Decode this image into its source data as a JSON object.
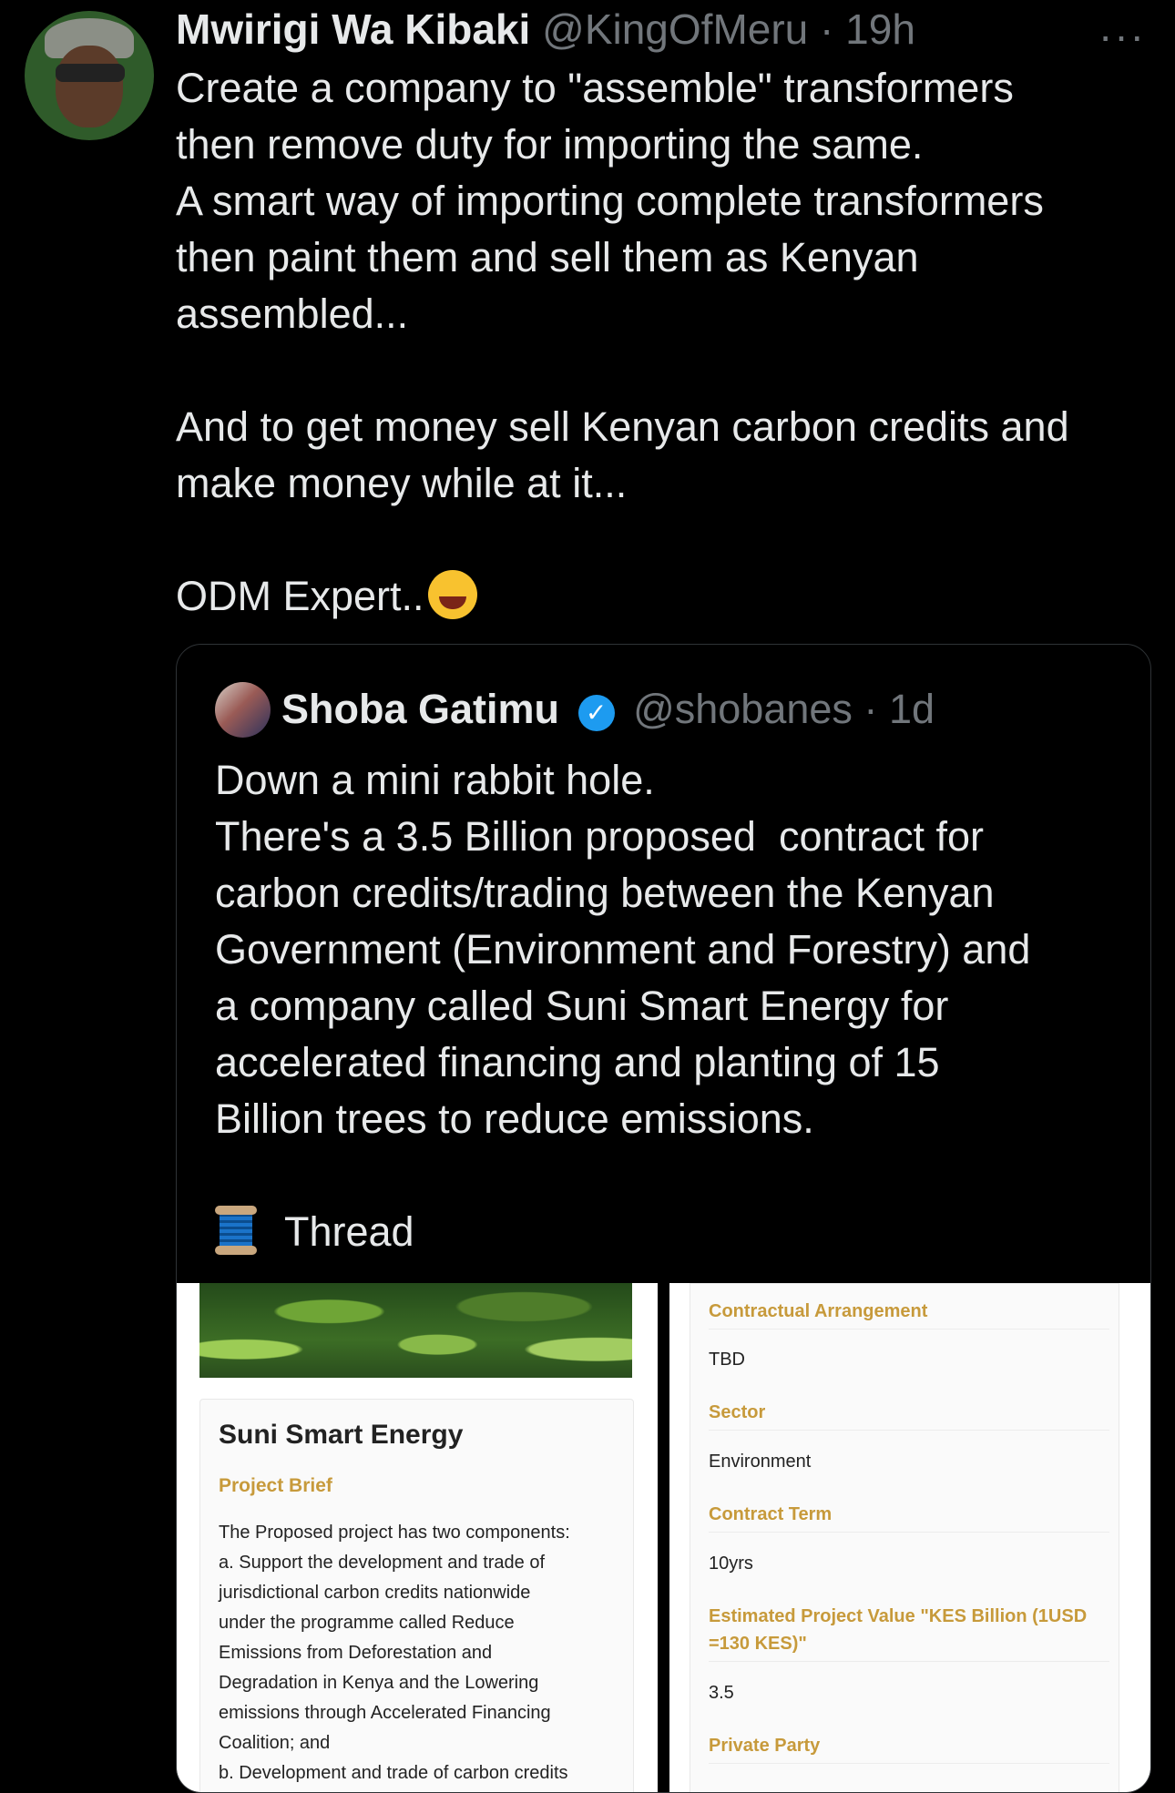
{
  "tweet": {
    "author_name": "Mwirigi Wa Kibaki",
    "author_handle": "@KingOfMeru",
    "time": "19h",
    "more_icon": "···",
    "text_1": "Create a company to \"assemble\" transformers\nthen remove duty for importing the same.\nA smart way of importing complete transformers\nthen paint them and sell them as Kenyan\nassembled...\n\nAnd to get money sell Kenyan carbon credits and\nmake money while at it...\n\n",
    "text_2": "ODM Expert.."
  },
  "quote": {
    "author_name": "Shoba Gatimu",
    "verified_icon": "✓",
    "author_handle": "@shobanes",
    "time": "1d",
    "text": "Down a mini rabbit hole.\nThere's a 3.5 Billion proposed  contract for\ncarbon credits/trading between the Kenyan\nGovernment (Environment and Forestry) and\na company called Suni Smart Energy for\naccelerated financing and planting of 15\nBillion trees to reduce emissions.\n\n",
    "thread_label": "Thread"
  },
  "images": {
    "left": {
      "title": "Suni Smart Energy",
      "brief_label": "Project Brief",
      "brief_text": "The Proposed project has two components:\na. Support the development and trade of\njurisdictional carbon credits nationwide\nunder the programme called Reduce\nEmissions from Deforestation and\nDegradation in Kenya and the Lowering\nemissions through Accelerated Financing\nCoalition; and\nb. Development and trade of carbon credits"
    },
    "right": {
      "fields": [
        {
          "label": "Contractual Arrangement",
          "value": "TBD"
        },
        {
          "label": "Sector",
          "value": "Environment"
        },
        {
          "label": "Contract Term",
          "value": "10yrs"
        },
        {
          "label": "Estimated Project Value \"KES Billion (1USD =130 KES)\"",
          "value": "3.5"
        },
        {
          "label": "Private Party",
          "value": ""
        }
      ]
    }
  }
}
